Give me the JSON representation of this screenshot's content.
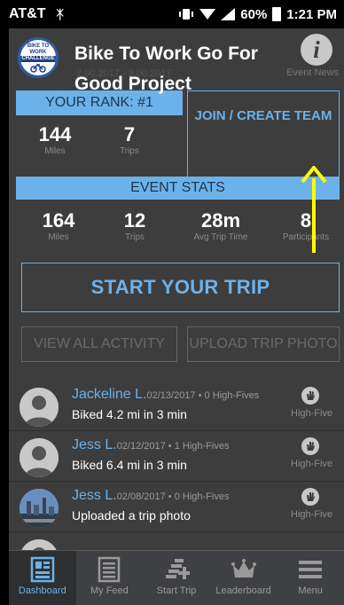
{
  "status_bar": {
    "carrier": "AT&T",
    "notification": "ᛡ",
    "battery": "60%",
    "time": "1:21 PM"
  },
  "header": {
    "logo_top": "BIKE TO WORK",
    "logo_mid": "CHALLENGE",
    "title": "Bike To Work Go For Good Project",
    "dates": "2.00.2017 - 3.00.2017",
    "info_glyph": "i",
    "event_news": "Event News"
  },
  "rank": {
    "label": "YOUR RANK: #1",
    "miles_value": "144",
    "miles_label": "Miles",
    "trips_value": "7",
    "trips_label": "Trips"
  },
  "join_team": {
    "label": "JOIN / CREATE TEAM"
  },
  "event_stats": {
    "label": "EVENT STATS",
    "items": [
      {
        "value": "164",
        "label": "Miles"
      },
      {
        "value": "12",
        "label": "Trips"
      },
      {
        "value": "28m",
        "label": "Avg Trip Time"
      },
      {
        "value": "8",
        "label": "Participants"
      }
    ]
  },
  "actions": {
    "start_trip": "START YOUR TRIP",
    "view_all": "VIEW ALL ACTIVITY",
    "upload_photo": "UPLOAD TRIP PHOTO"
  },
  "feed": [
    {
      "name": "Jackeline L.",
      "meta": "02/13/2017 • 0 High-Fives",
      "text": "Biked 4.2 mi in 3 min",
      "high_five": "High-Five"
    },
    {
      "name": "Jess L.",
      "meta": "02/12/2017 • 1 High-Fives",
      "text": "Biked 6.4 mi in 3 min",
      "high_five": "High-Five"
    },
    {
      "name": "Jess L.",
      "meta": "02/08/2017 • 0 High-Fives",
      "text": "Uploaded a trip photo",
      "high_five": "High-Five"
    }
  ],
  "tabs": [
    {
      "label": "Dashboard",
      "icon": "dashboard-icon",
      "active": true
    },
    {
      "label": "My Feed",
      "icon": "feed-icon",
      "active": false
    },
    {
      "label": "Start Trip",
      "icon": "start-trip-icon",
      "active": false
    },
    {
      "label": "Leaderboard",
      "icon": "crown-icon",
      "active": false
    },
    {
      "label": "Menu",
      "icon": "menu-icon",
      "active": false
    }
  ],
  "colors": {
    "accent": "#6cb2ea",
    "background": "#3d3d3d",
    "annotation_arrow": "#ffff00"
  }
}
